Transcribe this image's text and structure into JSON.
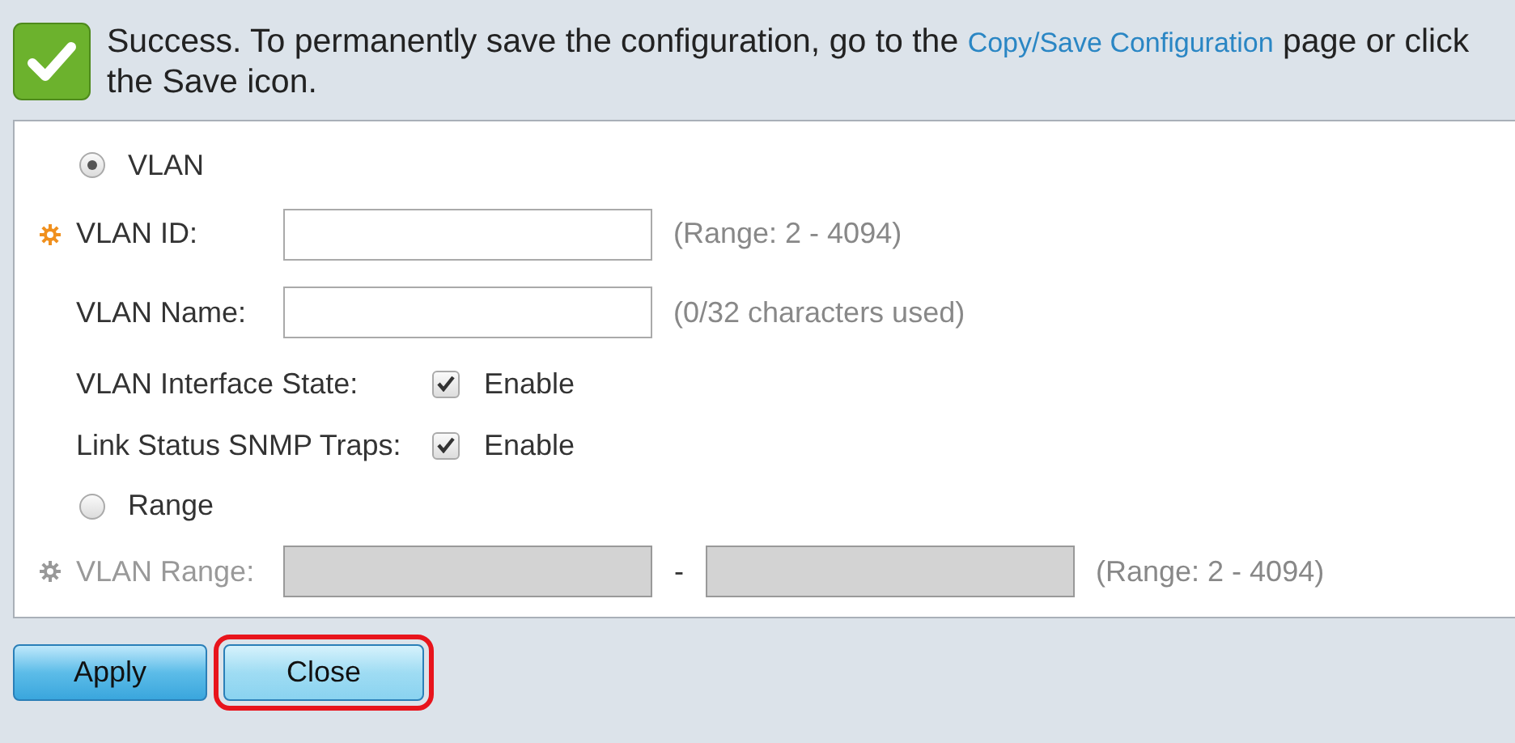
{
  "notice": {
    "text_before": "Success. To permanently save the configuration, go to the ",
    "link": "Copy/Save Configuration",
    "text_after": " page or click the Save icon."
  },
  "form": {
    "rows": [
      {
        "kind": "radio",
        "label": "VLAN",
        "selected": true
      },
      {
        "kind": "field",
        "label": "VLAN ID:",
        "required": true,
        "hint": "(Range: 2 - 4094)"
      },
      {
        "kind": "field",
        "label": "VLAN Name:",
        "required": false,
        "hint": "(0/32 characters used)"
      },
      {
        "kind": "checkbox",
        "label": "VLAN Interface State:",
        "option": "Enable",
        "checked": true
      },
      {
        "kind": "checkbox",
        "label": "Link Status SNMP Traps:",
        "option": "Enable",
        "checked": true
      },
      {
        "kind": "radio",
        "label": "Range",
        "selected": false
      },
      {
        "kind": "range",
        "label": "VLAN Range:",
        "required": true,
        "disabled": true,
        "separator": "-",
        "hint": "(Range: 2 - 4094)"
      }
    ]
  },
  "buttons": [
    {
      "label": "Apply",
      "highlighted": false
    },
    {
      "label": "Close",
      "highlighted": true
    }
  ]
}
